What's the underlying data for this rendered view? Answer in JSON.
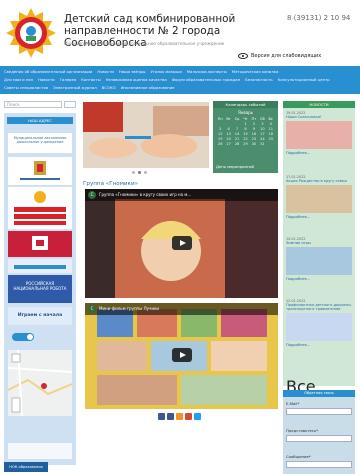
{
  "header": {
    "title": "Детский сад комбинированной направленности № 2 города Сосновоборска",
    "phone": "8 (39131) 2 10 94",
    "subtitle": "Муниципальное автономное дошкольное образовательное учреждение",
    "vision_label": "Версия для слабовидящих"
  },
  "nav": {
    "row1": [
      "Сведения об образовательной организации",
      "Новости",
      "Наши звёзды",
      "Уголок малыша",
      "Мальчики-эксперты",
      "Методическая копилка"
    ],
    "row2": [
      "Для мам и пап",
      "Новости",
      "Галерея",
      "Контакты",
      "Независимая оценка качества",
      "Форум образовательных граждан",
      "Безопасность",
      "Консультационный центр"
    ],
    "row3": [
      "Советы специалистов",
      "Электронный журнал",
      "ВСОКО",
      "Инклюзивное образование"
    ]
  },
  "search": {
    "placeholder": "Поиск"
  },
  "sidebar": {
    "header": "НАШ АДРЕС",
    "org_text": "Муниципальное автономное дошкольное учреждение",
    "play_label": "Играем с начала",
    "ros_label": "РОССИЙСКАЯ НАЦИОНАЛЬНАЯ РОБОТА",
    "footer_badge": "НОК образования"
  },
  "main": {
    "group_title": "Группа «Гномики»",
    "video1_title": "Группа «Гномики» в кругу своих игр на м...",
    "video2_title": "Мини-фильм группы Лучики",
    "channel_letter": "С"
  },
  "calendar": {
    "header": "Календарь событий",
    "month": "Январь",
    "weekdays": [
      "Пн",
      "Вт",
      "Ср",
      "Чт",
      "Пт",
      "Сб",
      "Вс"
    ],
    "days": [
      "",
      "",
      "",
      "1",
      "2",
      "3",
      "4",
      "5",
      "6",
      "7",
      "8",
      "9",
      "10",
      "11",
      "12",
      "13",
      "14",
      "15",
      "16",
      "17",
      "18",
      "19",
      "20",
      "21",
      "22",
      "23",
      "24",
      "25",
      "26",
      "27",
      "28",
      "29",
      "30",
      "31"
    ],
    "footer": "День мероприятий"
  },
  "news": {
    "header": "НОВОСТИ",
    "items": [
      {
        "date": "19.01.2022",
        "title": "Наши Сказочники!",
        "more": "Подробнее..."
      },
      {
        "date": "17.01.2022",
        "title": "Акция Рождество в кругу семьи",
        "more": "Подробнее..."
      },
      {
        "date": "14.01.2022",
        "title": "Зимние игры",
        "more": "Подробнее..."
      },
      {
        "date": "12.01.2022",
        "title": "Профилактика детского дорожно-транспортного травматизма",
        "more": "Подробнее..."
      }
    ],
    "all_news": "Все новости >>"
  },
  "feedback": {
    "header": "Обратная связь",
    "email_label": "E-Mail*",
    "name_label": "Представьтесь*",
    "message_label": "Сообщение*"
  },
  "colors": {
    "accent": "#2a8fd0",
    "calendar": "#4a8e6e",
    "news_bg": "#cfe7d4",
    "sidebar_bg": "#cfe0f2"
  }
}
